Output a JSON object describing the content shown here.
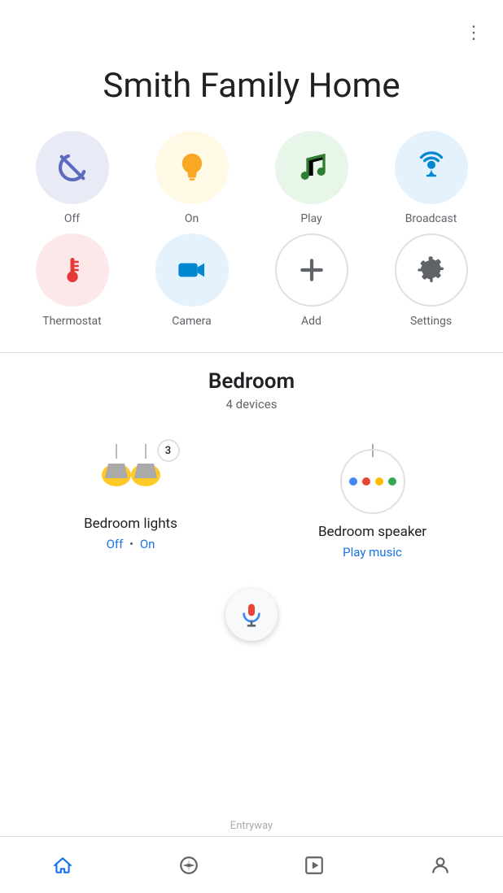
{
  "header": {
    "more_icon": "⋮",
    "title": "Smith Family Home"
  },
  "quick_actions": [
    {
      "id": "off",
      "label": "Off",
      "circle_class": "circle-off",
      "icon_type": "off"
    },
    {
      "id": "on",
      "label": "On",
      "circle_class": "circle-on",
      "icon_type": "on"
    },
    {
      "id": "play",
      "label": "Play",
      "circle_class": "circle-play",
      "icon_type": "play"
    },
    {
      "id": "broadcast",
      "label": "Broadcast",
      "circle_class": "circle-broadcast",
      "icon_type": "broadcast"
    },
    {
      "id": "thermostat",
      "label": "Thermostat",
      "circle_class": "circle-thermostat",
      "icon_type": "thermostat"
    },
    {
      "id": "camera",
      "label": "Camera",
      "circle_class": "circle-camera",
      "icon_type": "camera"
    },
    {
      "id": "add",
      "label": "Add",
      "circle_class": "circle-add",
      "icon_type": "add"
    },
    {
      "id": "settings",
      "label": "Settings",
      "circle_class": "circle-settings",
      "icon_type": "settings"
    }
  ],
  "room": {
    "name": "Bedroom",
    "device_count": "4 devices"
  },
  "devices": [
    {
      "id": "bedroom-lights",
      "name": "Bedroom lights",
      "status_text": "Off • On",
      "badge": "3",
      "has_badge": true,
      "type": "lights"
    },
    {
      "id": "bedroom-speaker",
      "name": "Bedroom speaker",
      "status_text": "Play music",
      "has_badge": false,
      "type": "speaker"
    }
  ],
  "bottom_nav": [
    {
      "id": "home",
      "label": "Home",
      "icon_type": "home",
      "active": true
    },
    {
      "id": "explore",
      "label": "Explore",
      "icon_type": "compass"
    },
    {
      "id": "media",
      "label": "Media",
      "icon_type": "media"
    },
    {
      "id": "account",
      "label": "Account",
      "icon_type": "person"
    }
  ],
  "entryway_label": "Entryway",
  "colors": {
    "active_blue": "#1a73e8",
    "text_primary": "#202124",
    "text_secondary": "#5f6368"
  }
}
